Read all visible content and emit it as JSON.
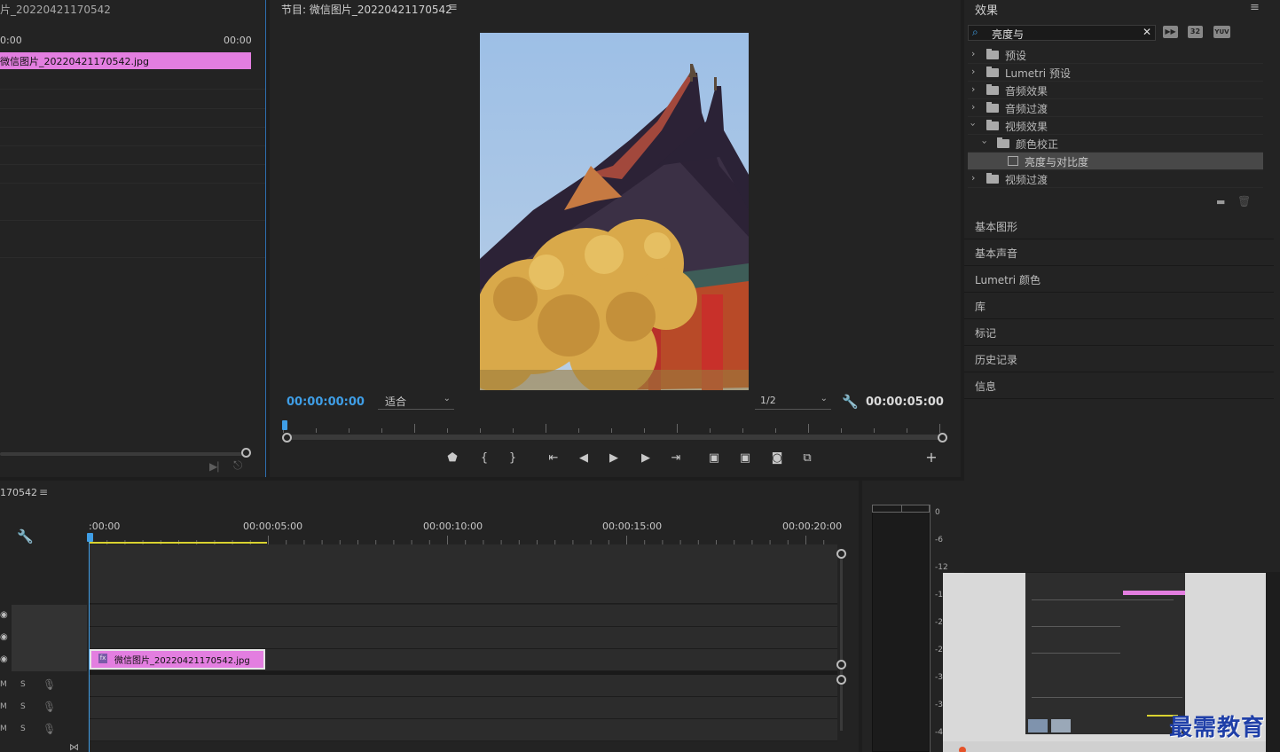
{
  "source": {
    "title": "片_20220421170542",
    "timecode_left": "0:00",
    "timecode_right": "00:00",
    "clip_name": "微信图片_20220421170542.jpg"
  },
  "program": {
    "title": "节目: 微信图片_20220421170542",
    "current_timecode": "00:00:00:00",
    "zoom": "适合",
    "resolution": "1/2",
    "duration": "00:00:05:00",
    "add_button": "+"
  },
  "effects": {
    "title": "效果",
    "search_value": "亮度与",
    "badges": [
      "32",
      "YUV"
    ],
    "tree": [
      {
        "label": "预设",
        "expanded": false,
        "level": 0
      },
      {
        "label": "Lumetri 预设",
        "expanded": false,
        "level": 0
      },
      {
        "label": "音频效果",
        "expanded": false,
        "level": 0
      },
      {
        "label": "音频过渡",
        "expanded": false,
        "level": 0
      },
      {
        "label": "视频效果",
        "expanded": true,
        "level": 0
      },
      {
        "label": "颜色校正",
        "expanded": true,
        "level": 1
      },
      {
        "label": "亮度与对比度",
        "selected": true,
        "level": 2
      },
      {
        "label": "视频过渡",
        "expanded": false,
        "level": 0
      }
    ],
    "stacked_panels": [
      "基本图形",
      "基本声音",
      "Lumetri 颜色",
      "库",
      "标记",
      "历史记录",
      "信息"
    ]
  },
  "timeline": {
    "title": "170542",
    "ruler_labels": [
      ":00:00",
      "00:00:05:00",
      "00:00:10:00",
      "00:00:15:00",
      "00:00:20:00"
    ],
    "clip_name": "微信图片_20220421170542.jpg",
    "clip_fx": "fx",
    "audio_track_labels": {
      "mute": "M",
      "solo": "S"
    }
  },
  "meter": {
    "db_labels": [
      "0",
      "-6",
      "-12",
      "-1",
      "-2",
      "-2",
      "-3",
      "-3",
      "-4"
    ]
  },
  "watermark": "最需教育",
  "colors": {
    "accent_blue": "#3f9ee6",
    "clip_pink": "#e37ee0",
    "inout_yellow": "#d9d230",
    "panel_bg": "#232323"
  }
}
